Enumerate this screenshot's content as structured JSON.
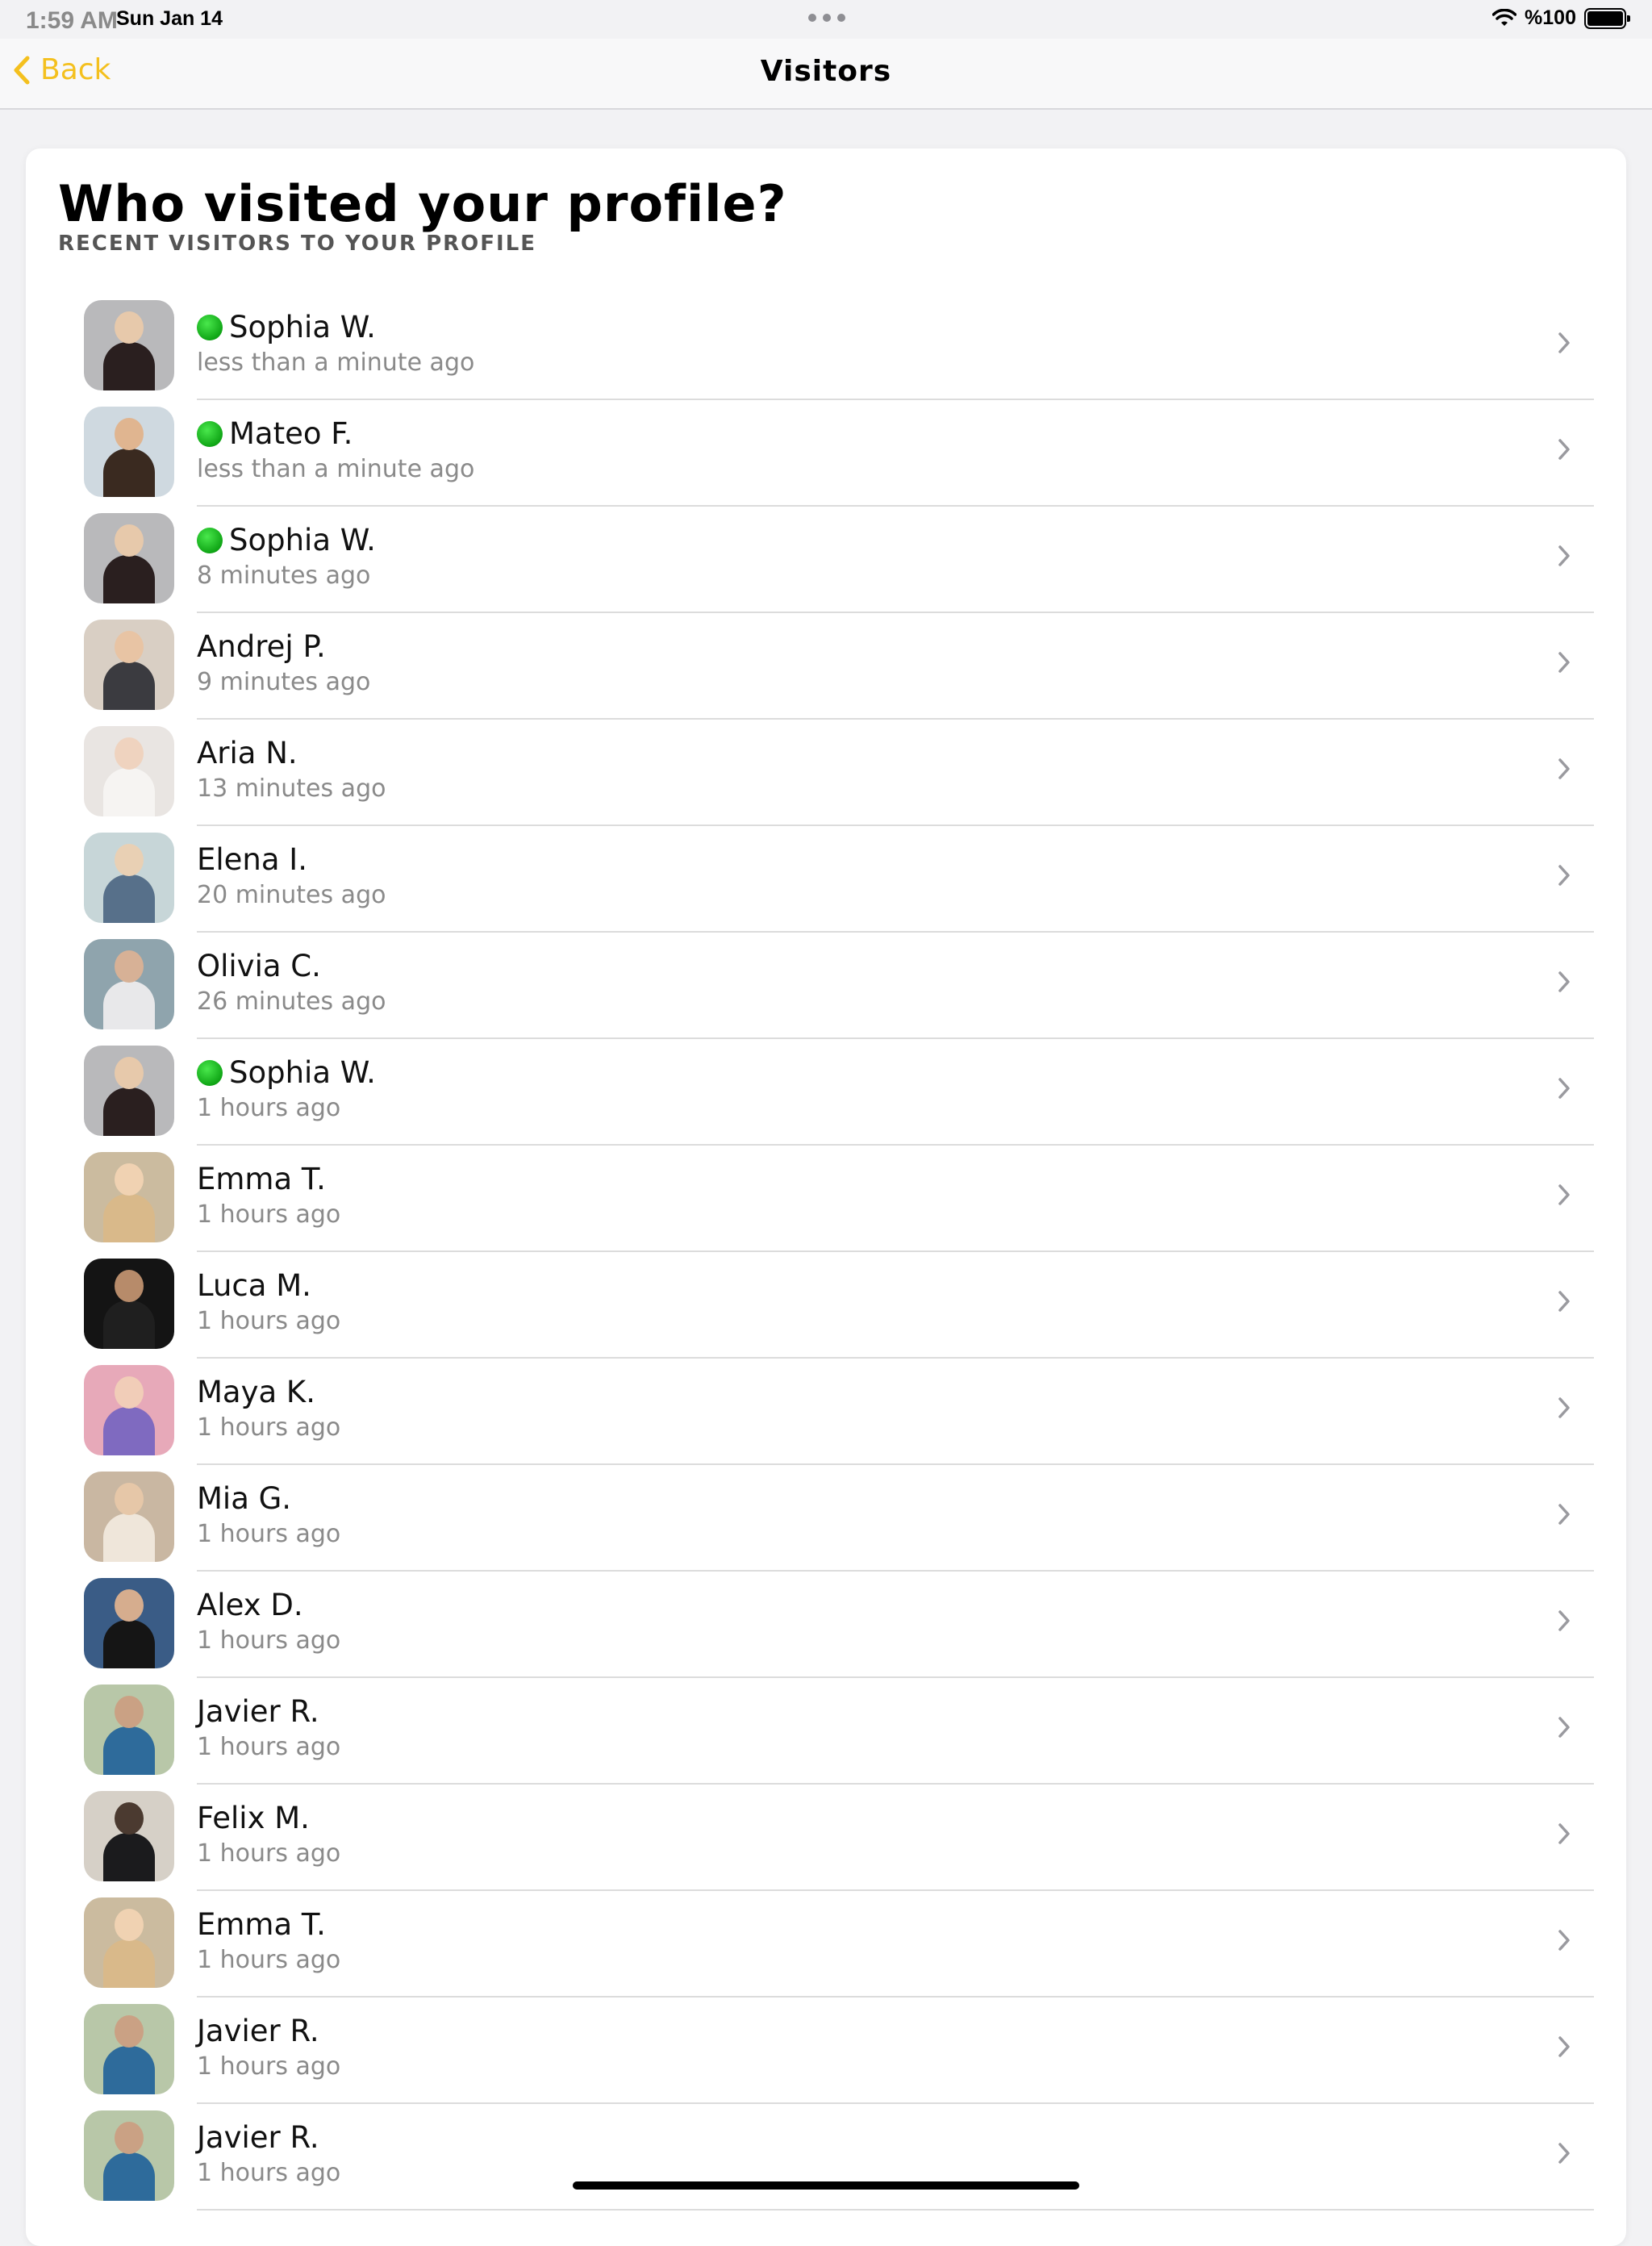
{
  "status_bar": {
    "time": "1:59 AM",
    "date": "Sun Jan 14",
    "battery": "%100",
    "battery_level": 1.0
  },
  "nav": {
    "back_label": "Back",
    "title": "Visitors",
    "accent_color": "#f4c01e"
  },
  "page": {
    "title": "Who visited your profile?",
    "subtitle": "RECENT VISITORS TO YOUR PROFILE"
  },
  "visitors": [
    {
      "name": "Sophia W.",
      "time": "less than a minute ago",
      "online": true,
      "avatar": [
        "#b9b9bb",
        "#e7c9ab",
        "#2a1f1f"
      ]
    },
    {
      "name": "Mateo F.",
      "time": "less than a minute ago",
      "online": true,
      "avatar": [
        "#cfd9e0",
        "#e0b590",
        "#3a2a20"
      ]
    },
    {
      "name": "Sophia W.",
      "time": "8 minutes ago",
      "online": true,
      "avatar": [
        "#b9b9bb",
        "#e7c9ab",
        "#2a1f1f"
      ]
    },
    {
      "name": "Andrej P.",
      "time": "9 minutes ago",
      "online": false,
      "avatar": [
        "#d9cfc4",
        "#e8c4a4",
        "#3b3b40"
      ]
    },
    {
      "name": "Aria N.",
      "time": "13 minutes ago",
      "online": false,
      "avatar": [
        "#e9e5e2",
        "#efd3bf",
        "#f6f4f2"
      ]
    },
    {
      "name": "Elena I.",
      "time": "20 minutes ago",
      "online": false,
      "avatar": [
        "#c7d6d8",
        "#e9d0b4",
        "#57708a"
      ]
    },
    {
      "name": "Olivia C.",
      "time": "26 minutes ago",
      "online": false,
      "avatar": [
        "#8fa4ad",
        "#d7b196",
        "#e8e8ea"
      ]
    },
    {
      "name": "Sophia W.",
      "time": "1 hours ago",
      "online": true,
      "avatar": [
        "#b9b9bb",
        "#e7c9ab",
        "#2a1f1f"
      ]
    },
    {
      "name": "Emma T.",
      "time": "1 hours ago",
      "online": false,
      "avatar": [
        "#cbbb9f",
        "#f0d2b2",
        "#d9b98a"
      ]
    },
    {
      "name": "Luca M.",
      "time": "1 hours ago",
      "online": false,
      "avatar": [
        "#141414",
        "#b78b6a",
        "#1f1f1f"
      ]
    },
    {
      "name": "Maya K.",
      "time": "1 hours ago",
      "online": false,
      "avatar": [
        "#e7a9b9",
        "#f1cdb8",
        "#7f6ac0"
      ]
    },
    {
      "name": "Mia G.",
      "time": "1 hours ago",
      "online": false,
      "avatar": [
        "#c9b7a2",
        "#e6c7a8",
        "#efe6da"
      ]
    },
    {
      "name": "Alex D.",
      "time": "1 hours ago",
      "online": false,
      "avatar": [
        "#3a5c86",
        "#d6ad8e",
        "#151515"
      ]
    },
    {
      "name": "Javier R.",
      "time": "1 hours ago",
      "online": false,
      "avatar": [
        "#b8c7a8",
        "#caa184",
        "#2e6b9b"
      ]
    },
    {
      "name": "Felix M.",
      "time": "1 hours ago",
      "online": false,
      "avatar": [
        "#d6d0c7",
        "#4b3a30",
        "#1b1b1d"
      ]
    },
    {
      "name": "Emma T.",
      "time": "1 hours ago",
      "online": false,
      "avatar": [
        "#cbbb9f",
        "#f0d2b2",
        "#d9b98a"
      ]
    },
    {
      "name": "Javier R.",
      "time": "1 hours ago",
      "online": false,
      "avatar": [
        "#b8c7a8",
        "#caa184",
        "#2e6b9b"
      ]
    },
    {
      "name": "Javier R.",
      "time": "1 hours ago",
      "online": false,
      "avatar": [
        "#b8c7a8",
        "#caa184",
        "#2e6b9b"
      ]
    }
  ]
}
